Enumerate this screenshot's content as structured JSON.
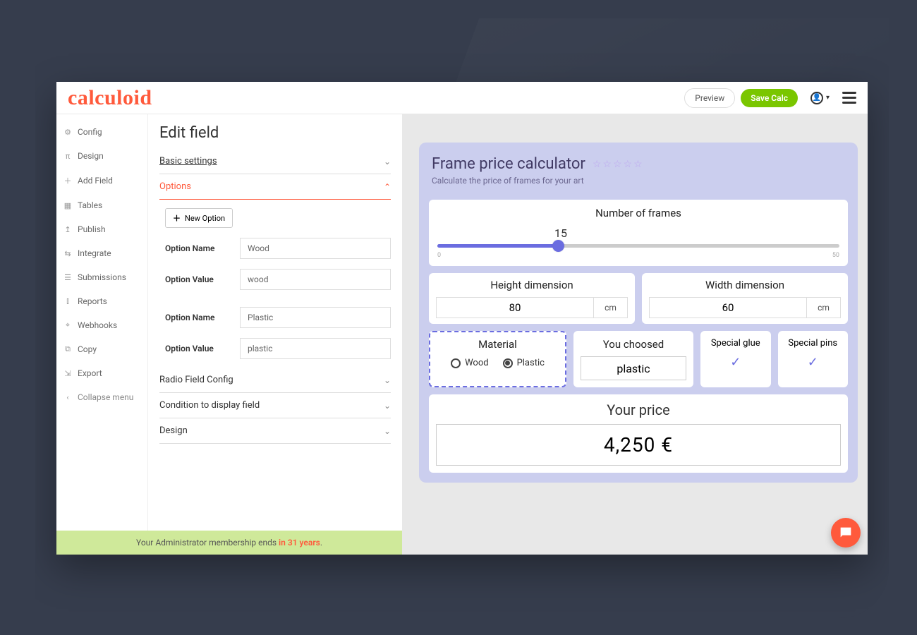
{
  "brand": "calculoid",
  "topbar": {
    "preview": "Preview",
    "save": "Save Calc"
  },
  "sidebar": {
    "items": [
      {
        "icon": "⚙",
        "label": "Config"
      },
      {
        "icon": "π",
        "label": "Design"
      },
      {
        "icon": "＋",
        "label": "Add Field"
      },
      {
        "icon": "▦",
        "label": "Tables"
      },
      {
        "icon": "↥",
        "label": "Publish"
      },
      {
        "icon": "⇆",
        "label": "Integrate"
      },
      {
        "icon": "☰",
        "label": "Submissions"
      },
      {
        "icon": "⫾",
        "label": "Reports"
      },
      {
        "icon": "⌖",
        "label": "Webhooks"
      },
      {
        "icon": "⧉",
        "label": "Copy"
      },
      {
        "icon": "⇲",
        "label": "Export"
      }
    ],
    "collapse": {
      "icon": "‹",
      "label": "Collapse menu"
    }
  },
  "edit": {
    "title": "Edit field",
    "acc_basic": "Basic settings",
    "acc_options": "Options",
    "new_option": "New Option",
    "label_name": "Option Name",
    "label_value": "Option Value",
    "opt1_name": "Wood",
    "opt1_value": "wood",
    "opt2_name": "Plastic",
    "opt2_value": "plastic",
    "acc_radio": "Radio Field Config",
    "acc_condition": "Condition to display field",
    "acc_design": "Design"
  },
  "calc": {
    "title": "Frame price calculator",
    "stars": "☆☆☆☆☆",
    "subtitle": "Calculate the price of frames for your art",
    "frames_label": "Number of frames",
    "frames_value": "15",
    "frames_min": "0",
    "frames_max": "50",
    "height_label": "Height dimension",
    "height_value": "80",
    "width_label": "Width dimension",
    "width_value": "60",
    "unit": "cm",
    "material_label": "Material",
    "material_wood": "Wood",
    "material_plastic": "Plastic",
    "chosen_label": "You choosed",
    "chosen_value": "plastic",
    "glue_label": "Special glue",
    "pins_label": "Special pins",
    "price_label": "Your price",
    "price_value": "4,250 €"
  },
  "footer": {
    "prefix": "Your Administrator membership ends ",
    "emph": "in 31 years",
    "suffix": "."
  }
}
